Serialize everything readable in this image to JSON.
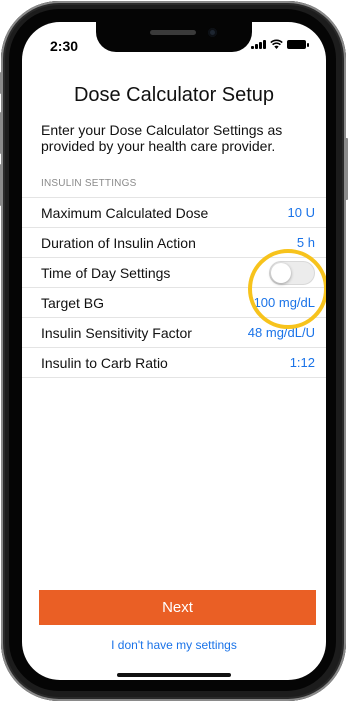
{
  "status_bar": {
    "time": "2:30"
  },
  "page": {
    "title": "Dose Calculator Setup",
    "subtitle": "Enter your Dose Calculator Settings as provided by your health care provider.",
    "section_header": "INSULIN SETTINGS"
  },
  "settings": [
    {
      "label": "Maximum Calculated Dose",
      "value": "10 U"
    },
    {
      "label": "Duration of Insulin Action",
      "value": "5 h"
    },
    {
      "label": "Time of Day Settings",
      "toggle_on": false
    },
    {
      "label": "Target BG",
      "value": "100 mg/dL"
    },
    {
      "label": "Insulin Sensitivity Factor",
      "value": "48 mg/dL/U"
    },
    {
      "label": "Insulin to Carb Ratio",
      "value": "1:12"
    }
  ],
  "actions": {
    "next_label": "Next",
    "no_settings_label": "I don't have my settings"
  },
  "colors": {
    "accent_orange": "#EA5F25",
    "link_blue": "#1A73E8",
    "highlight_yellow": "#F7C31C"
  }
}
